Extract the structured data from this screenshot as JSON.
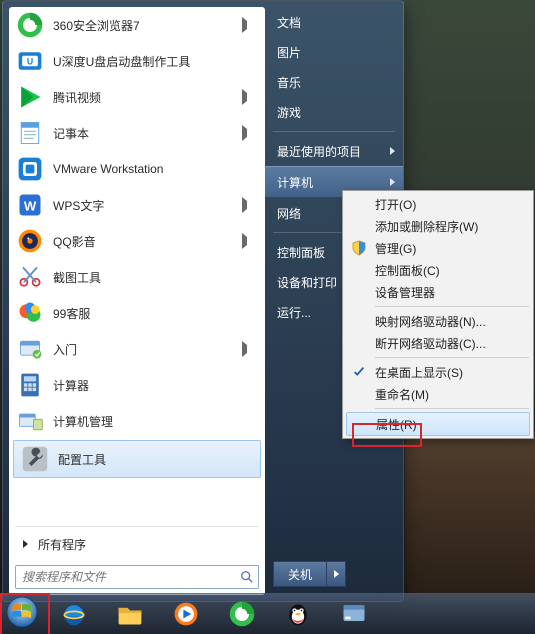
{
  "start_menu": {
    "programs": [
      {
        "label": "360安全浏览器7",
        "icon": "browser360",
        "arrow": true
      },
      {
        "label": "U深度U盘启动盘制作工具",
        "icon": "udepth",
        "arrow": false
      },
      {
        "label": "腾讯视频",
        "icon": "tencentvideo",
        "arrow": true
      },
      {
        "label": "记事本",
        "icon": "notepad",
        "arrow": true
      },
      {
        "label": "VMware Workstation",
        "icon": "vmware",
        "arrow": false
      },
      {
        "label": "WPS文字",
        "icon": "wps",
        "arrow": true
      },
      {
        "label": "QQ影音",
        "icon": "qqplayer",
        "arrow": true
      },
      {
        "label": "截图工具",
        "icon": "snipping",
        "arrow": false
      },
      {
        "label": "99客服",
        "icon": "chat99",
        "arrow": false
      },
      {
        "label": "入门",
        "icon": "gettingstarted",
        "arrow": true
      },
      {
        "label": "计算器",
        "icon": "calc",
        "arrow": false
      },
      {
        "label": "计算机管理",
        "icon": "mgmt",
        "arrow": false
      },
      {
        "label": "配置工具",
        "icon": "wrench",
        "arrow": false,
        "highlight": true
      }
    ],
    "all_programs_label": "所有程序",
    "search_placeholder": "搜索程序和文件",
    "right_items": [
      {
        "label": "文档"
      },
      {
        "label": "图片"
      },
      {
        "label": "音乐"
      },
      {
        "label": "游戏"
      },
      {
        "label": "最近使用的项目",
        "arrow": true
      },
      {
        "label": "计算机",
        "highlight": true,
        "arrow": true
      },
      {
        "label": "网络"
      },
      {
        "label": "控制面板"
      },
      {
        "label": "设备和打印"
      },
      {
        "label": "运行..."
      }
    ],
    "group_breaks": [
      4,
      7
    ],
    "shutdown_label": "关机"
  },
  "context_menu": {
    "groups": [
      [
        {
          "label": "打开(O)"
        },
        {
          "label": "添加或删除程序(W)"
        },
        {
          "label": "管理(G)",
          "icon": "shield"
        },
        {
          "label": "控制面板(C)"
        },
        {
          "label": "设备管理器"
        }
      ],
      [
        {
          "label": "映射网络驱动器(N)..."
        },
        {
          "label": "断开网络驱动器(C)..."
        }
      ],
      [
        {
          "label": "在桌面上显示(S)",
          "icon": "check"
        },
        {
          "label": "重命名(M)"
        }
      ],
      [
        {
          "label": "属性(R)",
          "highlight": true
        }
      ]
    ]
  },
  "taskbar_icons": [
    "start",
    "ie",
    "explorer",
    "wmp",
    "browser360",
    "qq",
    "task"
  ]
}
